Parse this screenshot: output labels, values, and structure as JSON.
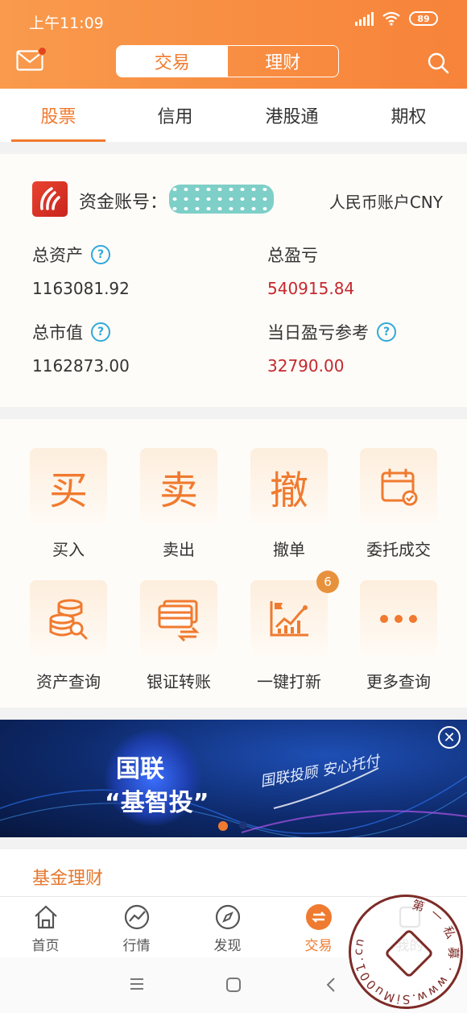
{
  "status_bar": {
    "time": "上午11:09",
    "battery": "89"
  },
  "header": {
    "segments": [
      "交易",
      "理财"
    ],
    "active_segment": "交易"
  },
  "tabs": [
    "股票",
    "信用",
    "港股通",
    "期权"
  ],
  "account": {
    "label": "资金账号：",
    "currency": "人民币账户CNY",
    "fields": [
      {
        "label": "总资产",
        "value": "1163081.92"
      },
      {
        "label": "总盈亏",
        "value": "540915.84"
      },
      {
        "label": "总市值",
        "value": "1162873.00"
      },
      {
        "label": "当日盈亏参考",
        "value": "32790.00"
      }
    ]
  },
  "functions": [
    {
      "icon": "buy-icon",
      "glyph": "买",
      "label": "买入"
    },
    {
      "icon": "sell-icon",
      "glyph": "卖",
      "label": "卖出"
    },
    {
      "icon": "cancel-order-icon",
      "glyph": "撤",
      "label": "撤单"
    },
    {
      "icon": "calendar-check-icon",
      "label": "委托成交"
    },
    {
      "icon": "coins-search-icon",
      "label": "资产查询"
    },
    {
      "icon": "card-transfer-icon",
      "label": "银证转账"
    },
    {
      "icon": "chart-flag-icon",
      "label": "一键打新",
      "badge": "6"
    },
    {
      "icon": "more-icon",
      "label": "更多查询"
    }
  ],
  "banner": {
    "title_line1": "国联",
    "title_line2": "“基智投”",
    "slogan": "国联投顾 安心托付"
  },
  "fund_section": {
    "title": "基金理财"
  },
  "bottom_nav": [
    {
      "icon": "home-icon",
      "label": "首页"
    },
    {
      "icon": "market-icon",
      "label": "行情"
    },
    {
      "icon": "compass-icon",
      "label": "发现"
    },
    {
      "icon": "trade-icon",
      "label": "交易",
      "active": true
    },
    {
      "icon": "mine-icon",
      "label": "我的"
    }
  ],
  "watermark": {
    "text": "第一私募 www.SiMu001.cn"
  },
  "colors": {
    "accent": "#f07a2f",
    "profit_red": "#c5282e",
    "help_blue": "#2fa8dd"
  }
}
